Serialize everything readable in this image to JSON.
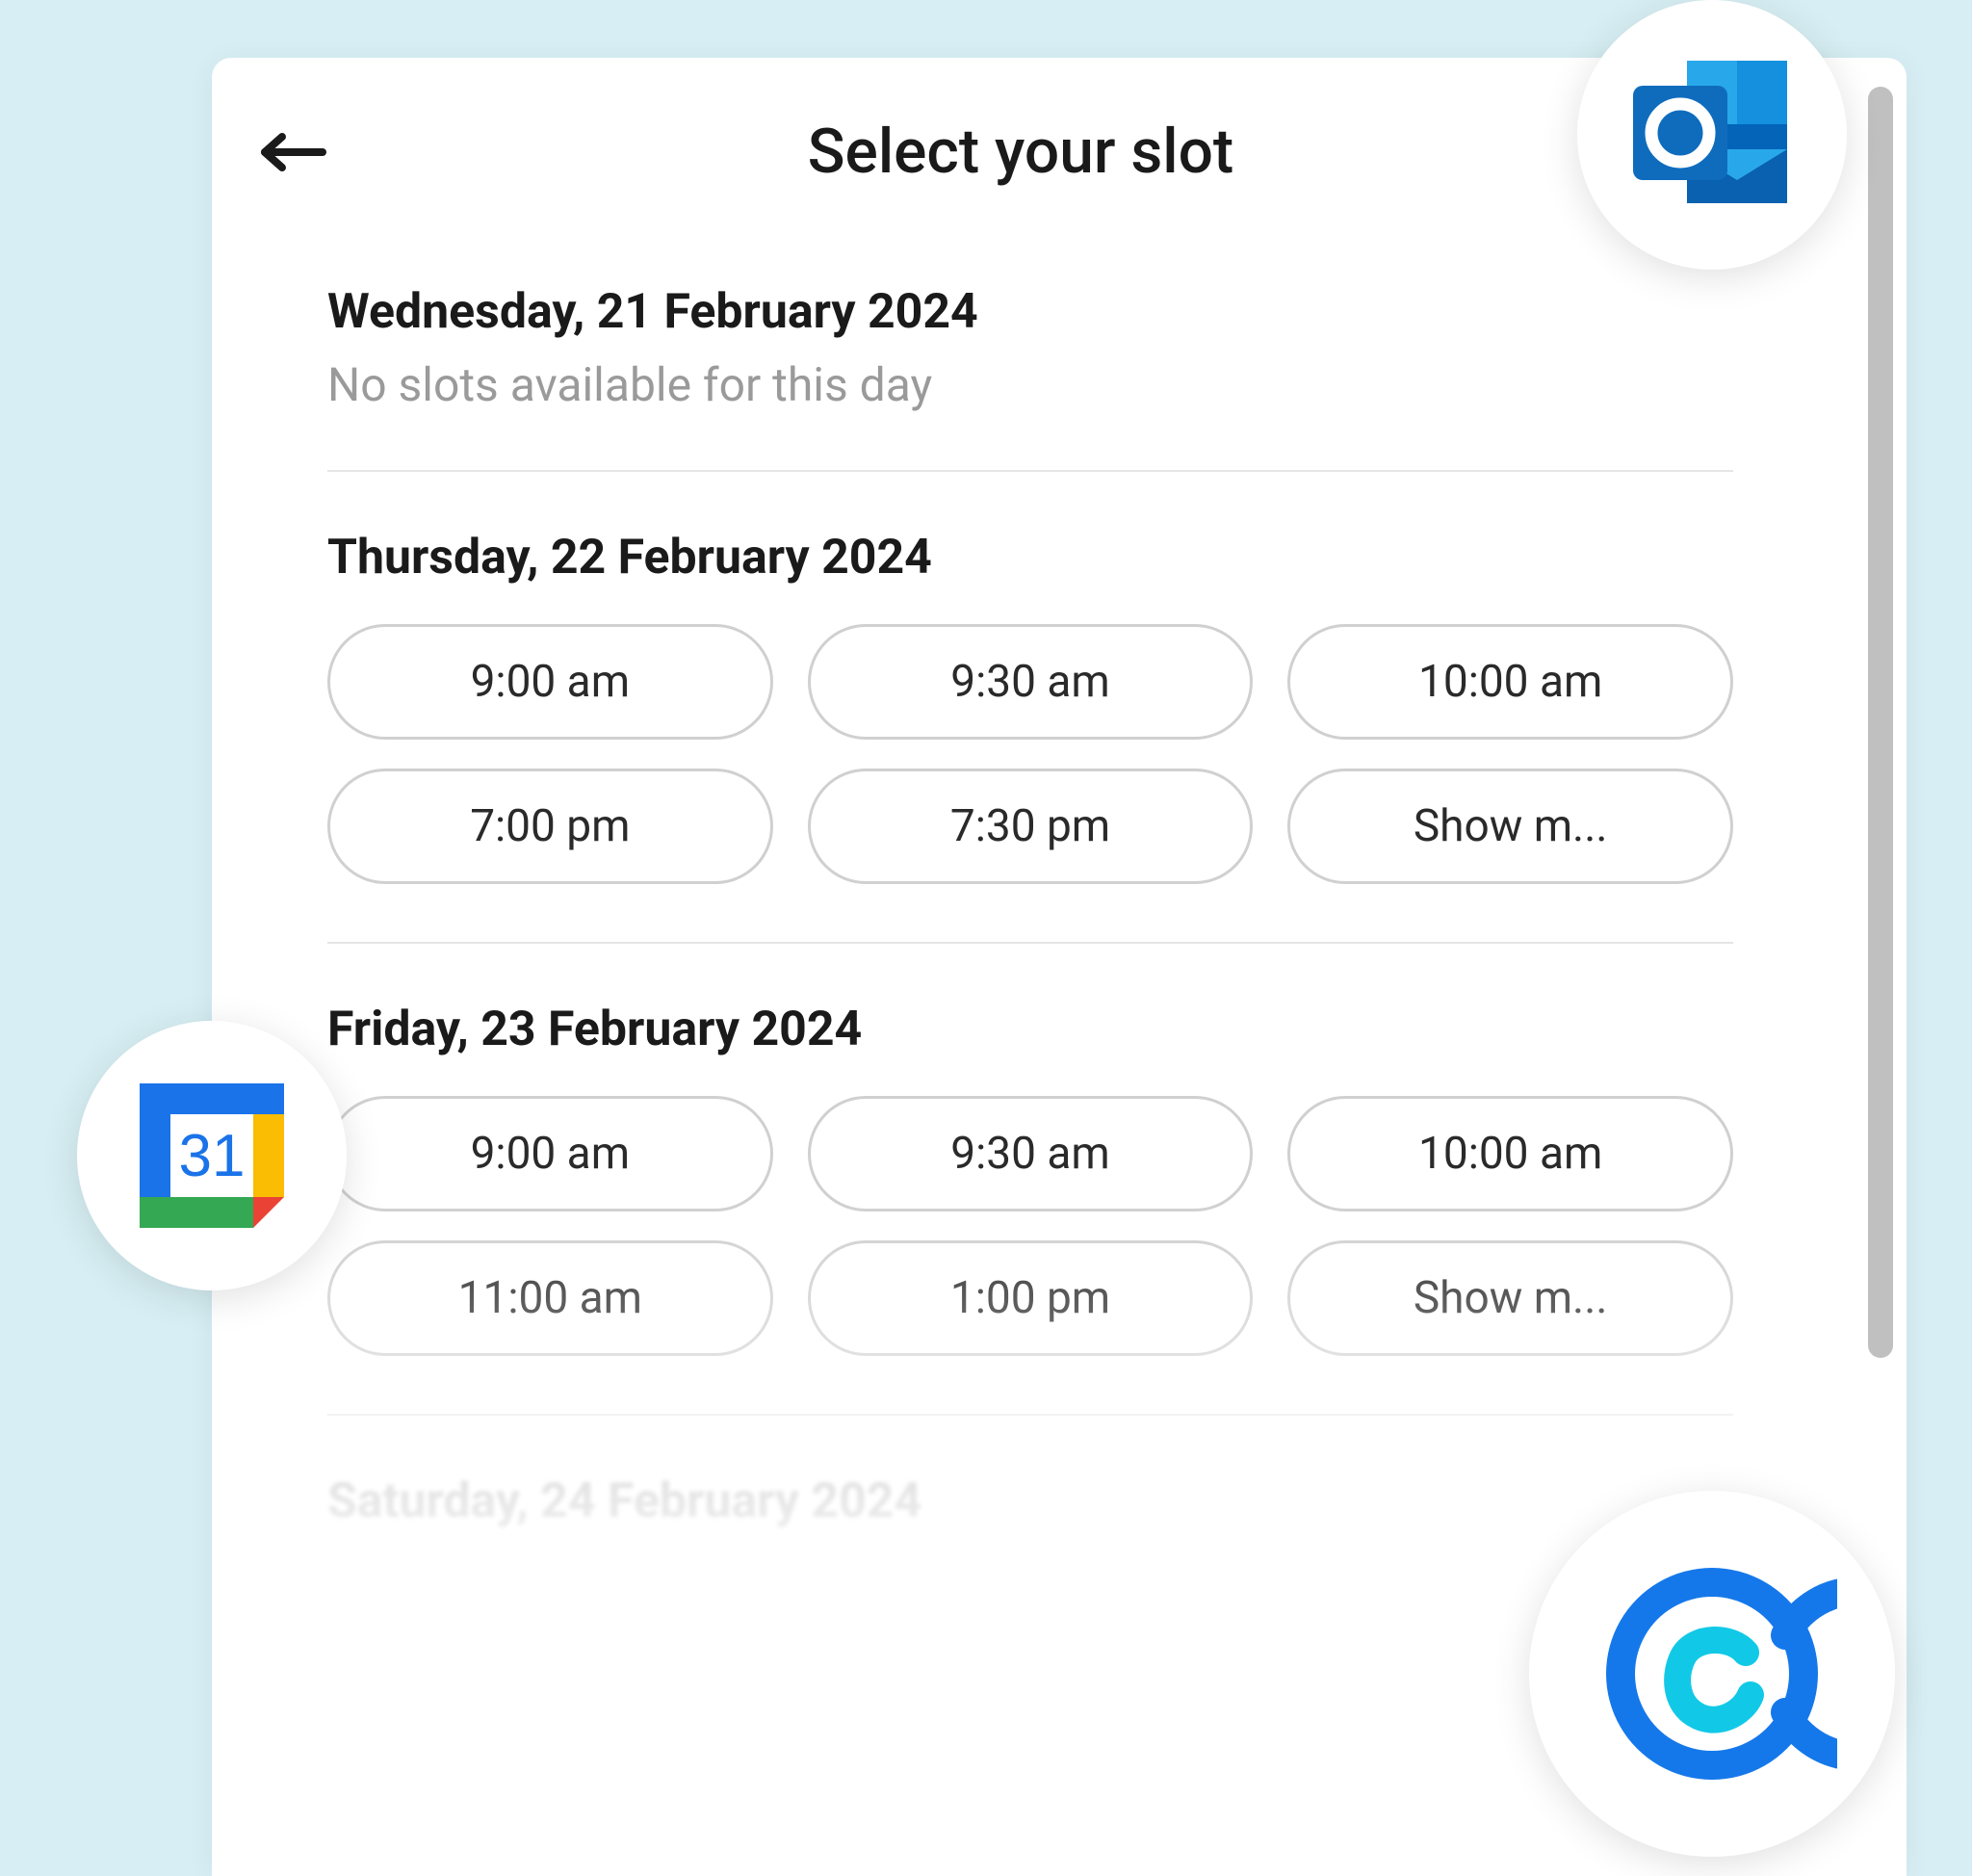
{
  "header": {
    "title": "Select your slot"
  },
  "days": [
    {
      "label": "Wednesday, 21 February 2024",
      "no_slots_message": "No slots available for this day",
      "slots": []
    },
    {
      "label": "Thursday, 22 February 2024",
      "slots": [
        "9:00 am",
        "9:30 am",
        "10:00 am",
        "7:00 pm",
        "7:30 pm"
      ],
      "show_more_label": "Show m..."
    },
    {
      "label": "Friday, 23 February 2024",
      "slots": [
        "9:00 am",
        "9:30 am",
        "10:00 am",
        "11:00 am",
        "1:00 pm"
      ],
      "show_more_label": "Show m..."
    },
    {
      "label": "Saturday, 24 February 2024",
      "slots": []
    }
  ],
  "badges": {
    "outlook": "outlook-icon",
    "gcal": "google-calendar-icon",
    "gcal_day": "31",
    "calendly": "calendly-icon"
  }
}
